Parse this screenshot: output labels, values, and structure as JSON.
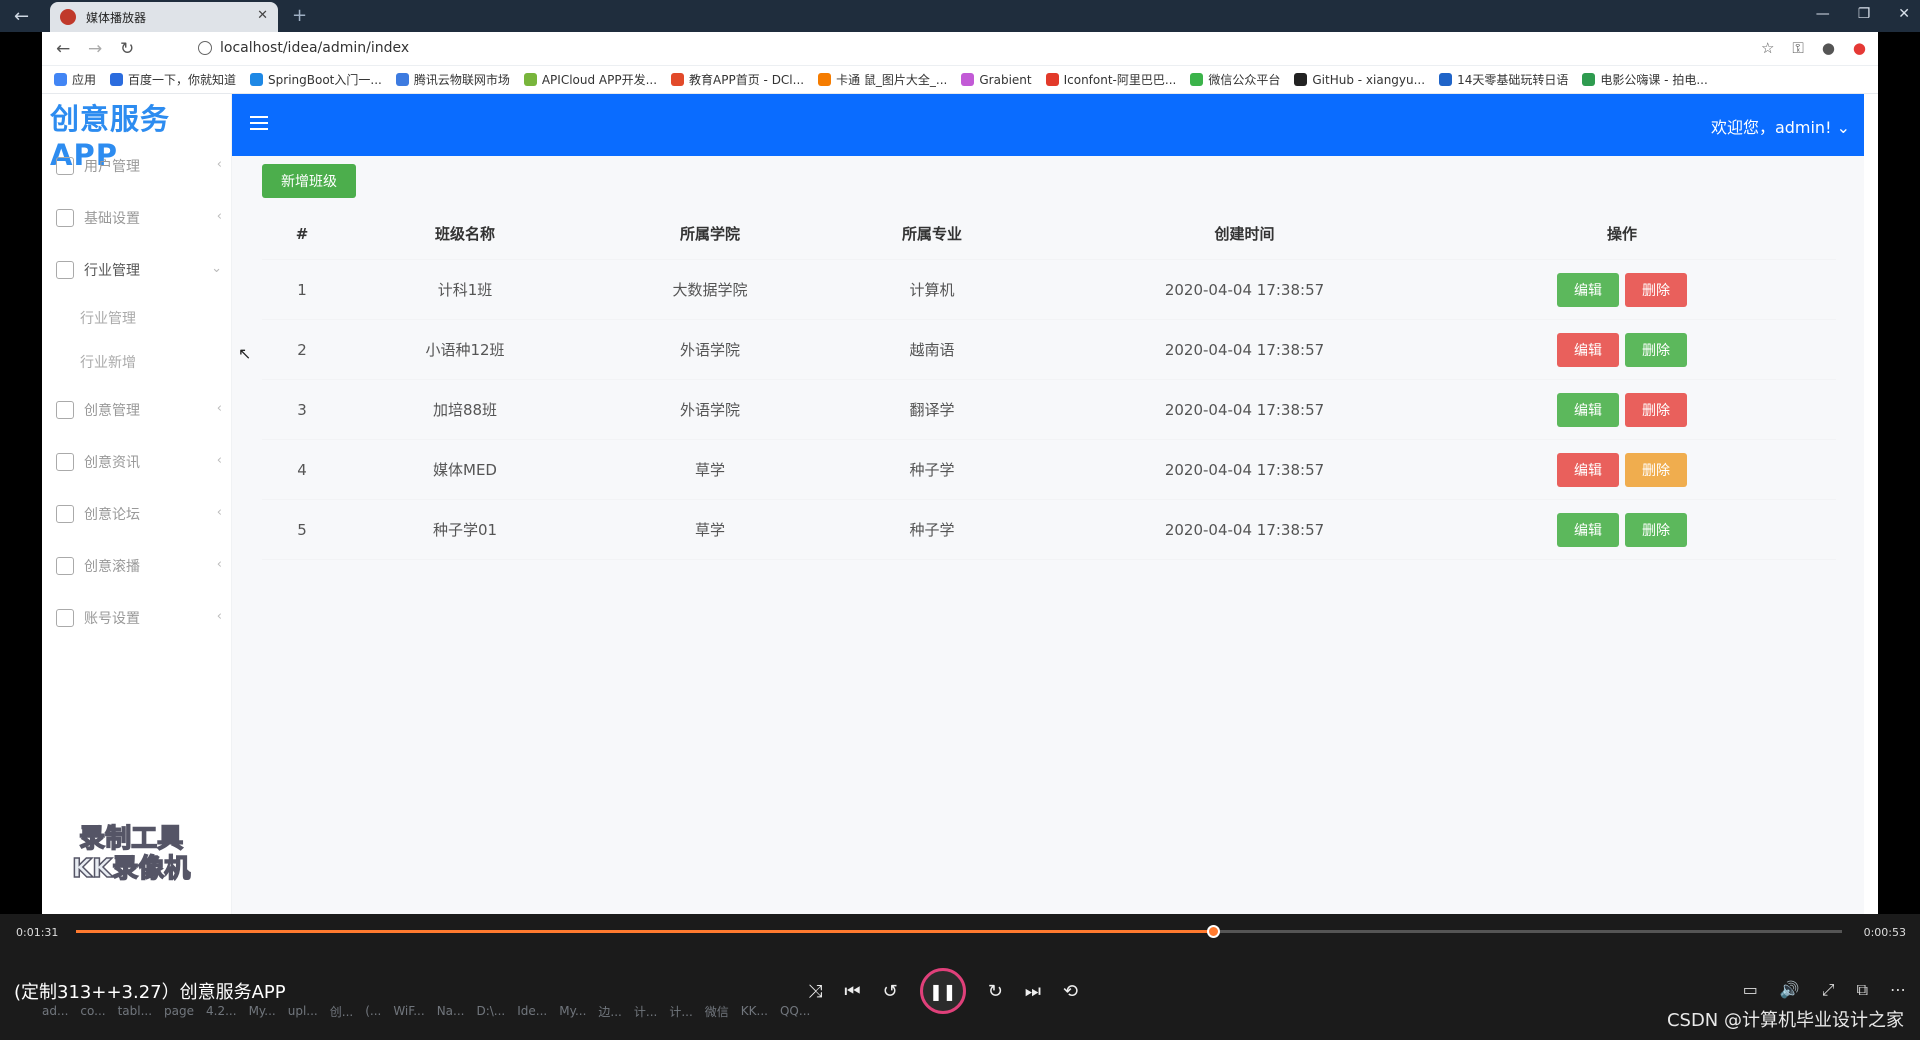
{
  "player": {
    "tab_title": "媒体播放器",
    "time_current": "0:01:31",
    "time_total": "0:00:53",
    "progress": 0.644,
    "video_title": "(定制313++3.27）创意服务APP",
    "credit": "CSDN @计算机毕业设计之家"
  },
  "browser": {
    "url": "localhost/idea/admin/index",
    "bookmarks": [
      "应用",
      "百度一下，你就知道",
      "SpringBoot入门一...",
      "腾讯云物联网市场",
      "APICloud APP开发...",
      "教育APP首页 - DCl...",
      "卡通 鼠_图片大全_...",
      "Grabient",
      "Iconfont-阿里巴巴...",
      "微信公众平台",
      "GitHub - xiangyu...",
      "14天零基础玩转日语",
      "电影公嗨课 - 拍电..."
    ]
  },
  "app": {
    "logo": "创意服务APP",
    "welcome": "欢迎您，admin!",
    "menu": [
      {
        "label": "用户管理"
      },
      {
        "label": "基础设置"
      },
      {
        "label": "行业管理",
        "open": true,
        "children": [
          "行业管理",
          "行业新增"
        ]
      },
      {
        "label": "创意管理"
      },
      {
        "label": "创意资讯"
      },
      {
        "label": "创意论坛"
      },
      {
        "label": "创意滚播"
      },
      {
        "label": "账号设置"
      }
    ],
    "watermark": [
      "录制工具",
      "KK录像机"
    ],
    "add_button": "新增班级",
    "columns": [
      "#",
      "班级名称",
      "所属学院",
      "所属专业",
      "创建时间",
      "操作"
    ],
    "rows": [
      {
        "id": "1",
        "name": "计科1班",
        "college": "大数据学院",
        "major": "计算机",
        "time": "2020-04-04 17:38:57",
        "edit": "编辑",
        "del": "删除"
      },
      {
        "id": "2",
        "name": "小语种12班",
        "college": "外语学院",
        "major": "越南语",
        "time": "2020-04-04 17:38:57",
        "edit": "编辑",
        "del": "删除"
      },
      {
        "id": "3",
        "name": "加培88班",
        "college": "外语学院",
        "major": "翻译学",
        "time": "2020-04-04 17:38:57",
        "edit": "编辑",
        "del": "删除"
      },
      {
        "id": "4",
        "name": "媒体MED",
        "college": "草学",
        "major": "种子学",
        "time": "2020-04-04 17:38:57",
        "edit": "编辑",
        "del": "删除"
      },
      {
        "id": "5",
        "name": "种子学01",
        "college": "草学",
        "major": "种子学",
        "time": "2020-04-04 17:38:57",
        "edit": "编辑",
        "del": "删除"
      }
    ]
  },
  "taskbar": [
    "ad...",
    "co...",
    "tabl...",
    "page",
    "4.2...",
    "My...",
    "upl...",
    "创...",
    "(...",
    "WiF...",
    "Na...",
    "D:\\...",
    "Ide...",
    "My...",
    "边...",
    "计...",
    "计...",
    "微信",
    "KK...",
    "QQ..."
  ]
}
